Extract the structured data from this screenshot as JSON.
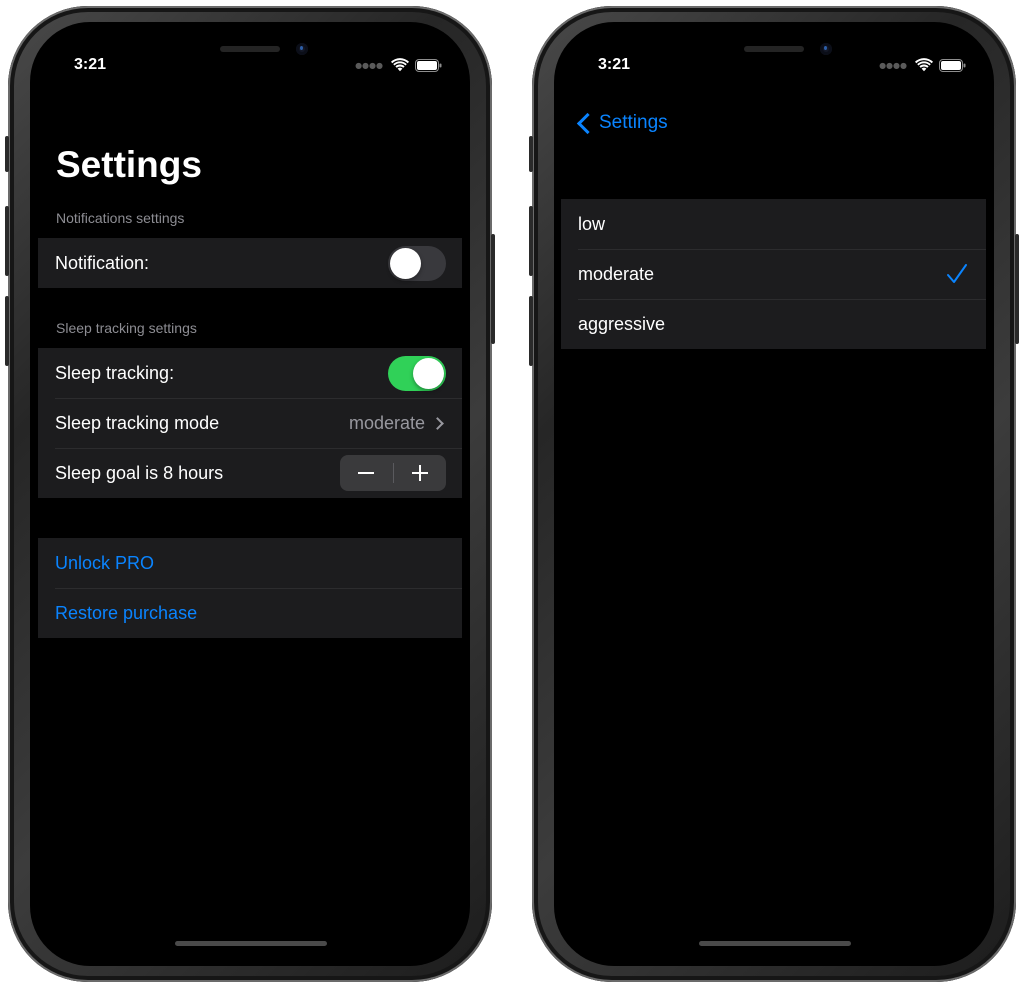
{
  "left_screen": {
    "status_time": "3:21",
    "title": "Settings",
    "notifications_section": {
      "header": "Notifications settings",
      "notification_label": "Notification:",
      "notification_on": false
    },
    "sleep_section": {
      "header": "Sleep tracking settings",
      "tracking_label": "Sleep tracking:",
      "tracking_on": true,
      "mode_label": "Sleep tracking mode",
      "mode_value": "moderate",
      "goal_label": "Sleep goal is 8 hours"
    },
    "purchase_section": {
      "unlock_label": "Unlock PRO",
      "restore_label": "Restore purchase"
    }
  },
  "right_screen": {
    "status_time": "3:21",
    "back_label": "Settings",
    "options": [
      {
        "label": "low",
        "selected": false
      },
      {
        "label": "moderate",
        "selected": true
      },
      {
        "label": "aggressive",
        "selected": false
      }
    ]
  },
  "colors": {
    "accent": "#0a84ff",
    "toggle_on": "#30d158",
    "cell_background": "#1c1c1e",
    "secondary_text": "#8d8d93"
  },
  "icons": {
    "wifi": "wifi-icon",
    "battery": "battery-icon",
    "signal": "cellular-signal-icon",
    "chevron": "chevron-right-icon",
    "back": "chevron-left-icon",
    "check": "checkmark-icon"
  }
}
